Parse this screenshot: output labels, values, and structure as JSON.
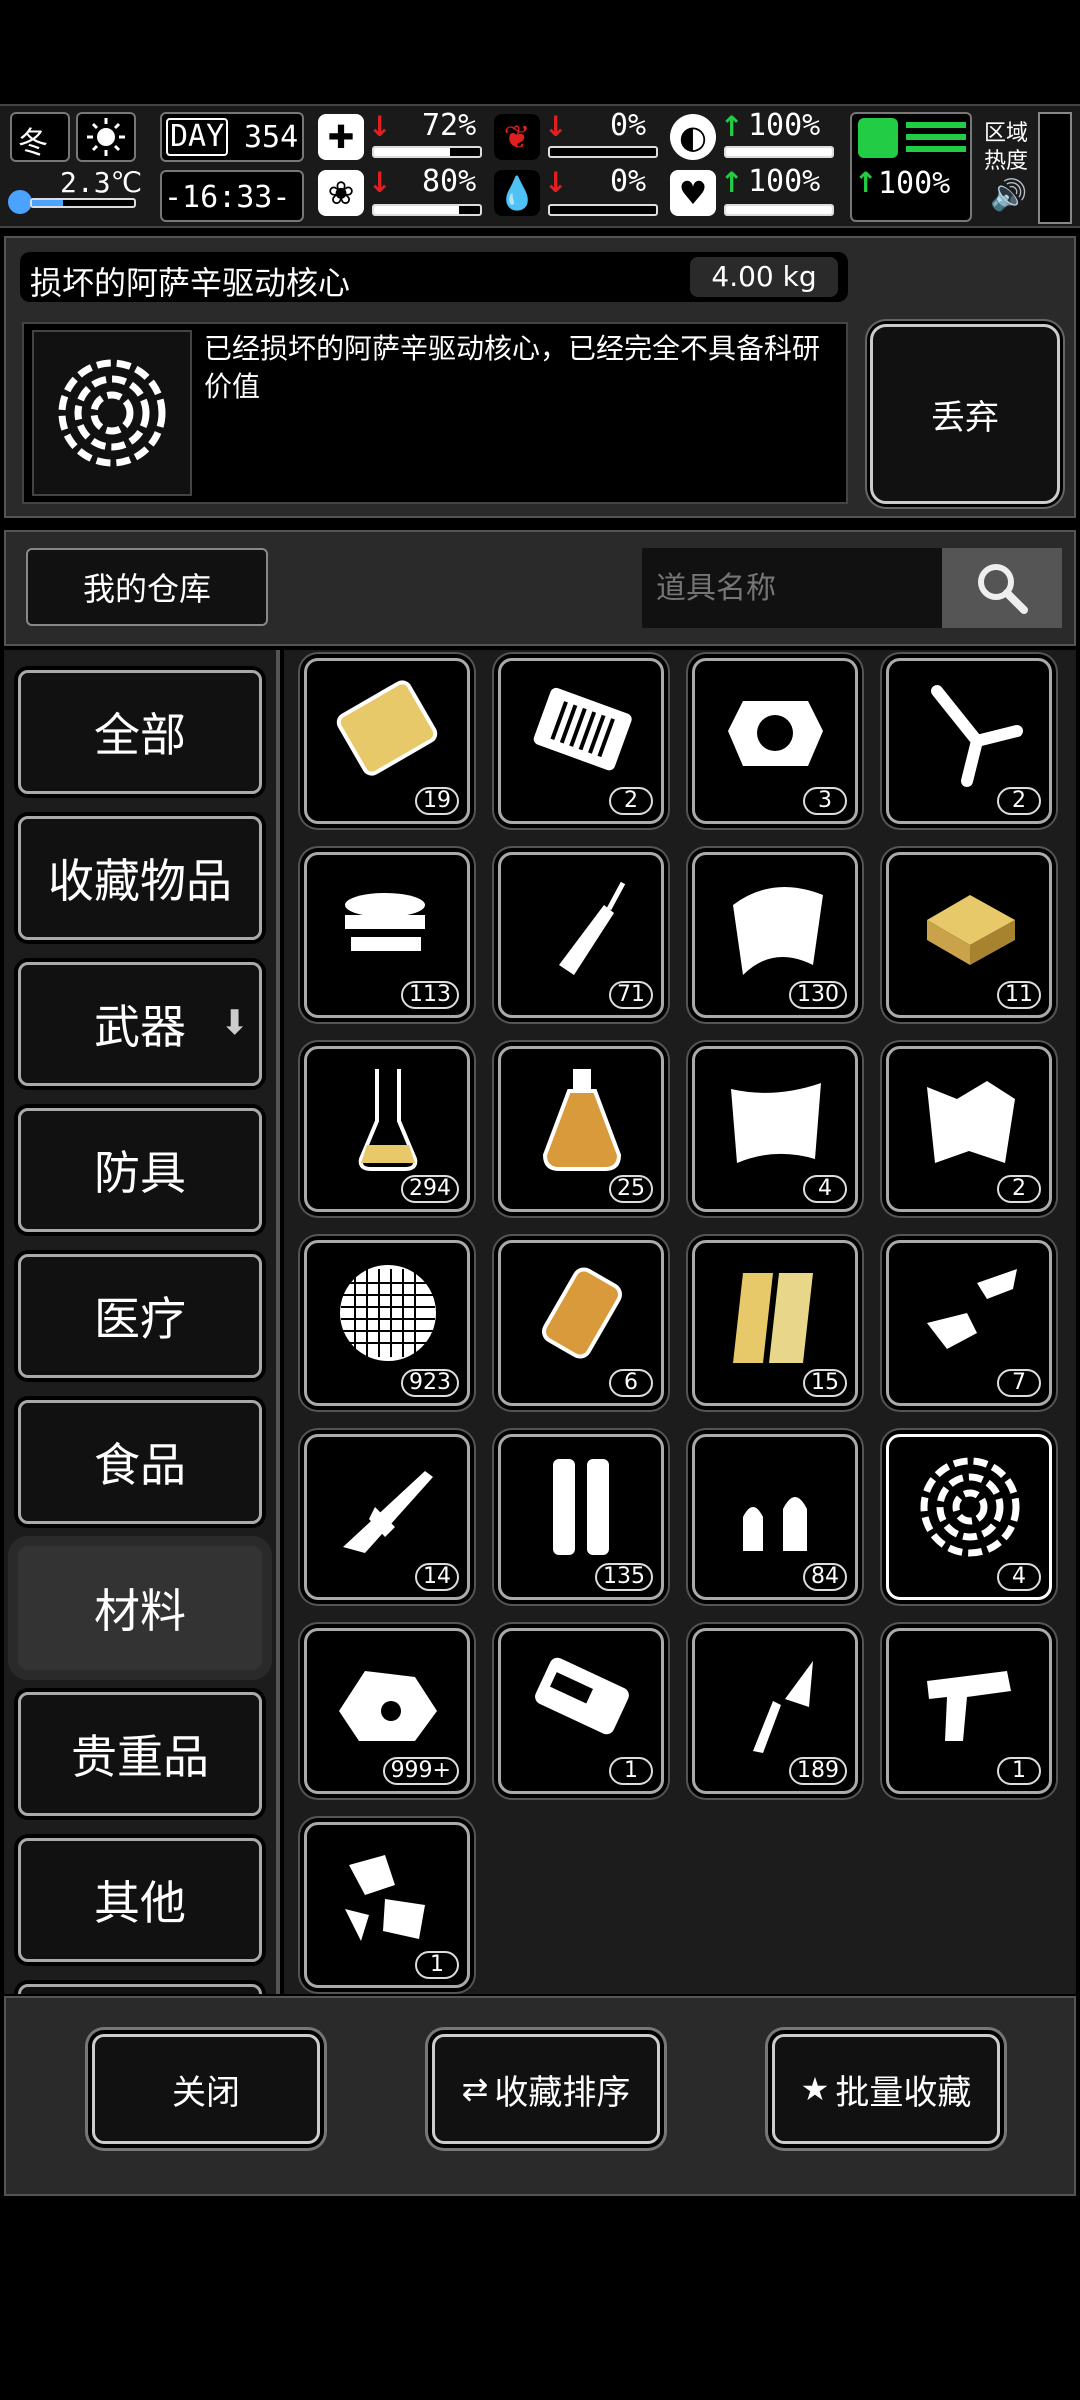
{
  "hud": {
    "season": "冬",
    "temperature": "2.3℃",
    "day_label": "DAY",
    "day_value": "354",
    "clock": "-16:33-",
    "zone_heat_label": "区域\n热度",
    "stats": [
      {
        "name": "health",
        "icon": "medkit-icon",
        "trend": "down",
        "pct_text": "72%",
        "level": 0.72
      },
      {
        "name": "hunger",
        "icon": "stomach-icon",
        "trend": "down",
        "pct_text": "0%",
        "level": 0
      },
      {
        "name": "stamina",
        "icon": "lungs-icon",
        "trend": "up",
        "pct_text": "100%",
        "level": 1.0
      },
      {
        "name": "mental",
        "icon": "brain-icon",
        "trend": "down",
        "pct_text": "80%",
        "level": 0.8
      },
      {
        "name": "thirst",
        "icon": "water-drop-icon",
        "trend": "down",
        "pct_text": "0%",
        "level": 0
      },
      {
        "name": "mood",
        "icon": "heart-icon",
        "trend": "up",
        "pct_text": "100%",
        "level": 1.0
      }
    ],
    "foot_pct": "100%"
  },
  "detail": {
    "item_name": "损坏的阿萨辛驱动核心",
    "weight": "4.00 kg",
    "description": "已经损坏的阿萨辛驱动核心，已经完全不具备科研价值",
    "discard_label": "丢弃"
  },
  "warehouse": {
    "title": "我的仓库",
    "search_placeholder": "道具名称"
  },
  "categories": [
    {
      "label": "全部",
      "active": false
    },
    {
      "label": "收藏物品",
      "active": false
    },
    {
      "label": "武器",
      "active": false,
      "expand": true
    },
    {
      "label": "防具",
      "active": false
    },
    {
      "label": "医疗",
      "active": false
    },
    {
      "label": "食品",
      "active": false
    },
    {
      "label": "材料",
      "active": true
    },
    {
      "label": "贵重品",
      "active": false
    },
    {
      "label": "其他",
      "active": false
    }
  ],
  "items": [
    {
      "icon": "gold-plate-icon",
      "count": "19"
    },
    {
      "icon": "circuit-board-icon",
      "count": "2"
    },
    {
      "icon": "armor-core-icon",
      "count": "3"
    },
    {
      "icon": "pliers-icon",
      "count": "2"
    },
    {
      "icon": "tape-roll-icon",
      "count": "113"
    },
    {
      "icon": "glue-bottle-icon",
      "count": "71"
    },
    {
      "icon": "cloth-sheet-icon",
      "count": "130"
    },
    {
      "icon": "gold-bars-icon",
      "count": "11"
    },
    {
      "icon": "flask-icon",
      "count": "294"
    },
    {
      "icon": "potion-icon",
      "count": "25"
    },
    {
      "icon": "fur-pelt-icon",
      "count": "4"
    },
    {
      "icon": "hide-icon",
      "count": "2"
    },
    {
      "icon": "mesh-filter-icon",
      "count": "923"
    },
    {
      "icon": "engine-part-icon",
      "count": "6"
    },
    {
      "icon": "wood-planks-icon",
      "count": "15"
    },
    {
      "icon": "gun-parts-icon",
      "count": "7"
    },
    {
      "icon": "rifle-parts-icon",
      "count": "14"
    },
    {
      "icon": "shell-casings-icon",
      "count": "135"
    },
    {
      "icon": "bullets-icon",
      "count": "84"
    },
    {
      "icon": "broken-core-icon",
      "count": "4",
      "selected": true
    },
    {
      "icon": "ore-rock-icon",
      "count": "999+"
    },
    {
      "icon": "mechanism-icon",
      "count": "1"
    },
    {
      "icon": "drill-icon",
      "count": "189"
    },
    {
      "icon": "pistol-parts-icon",
      "count": "1"
    },
    {
      "icon": "scrap-pieces-icon",
      "count": "1"
    }
  ],
  "bottom": {
    "close_label": "关闭",
    "sort_label": "收藏排序",
    "batch_label": "批量收藏"
  },
  "colors": {
    "gold": "#e8c96a",
    "alert_red": "#e02020",
    "ok_green": "#22cc44"
  }
}
